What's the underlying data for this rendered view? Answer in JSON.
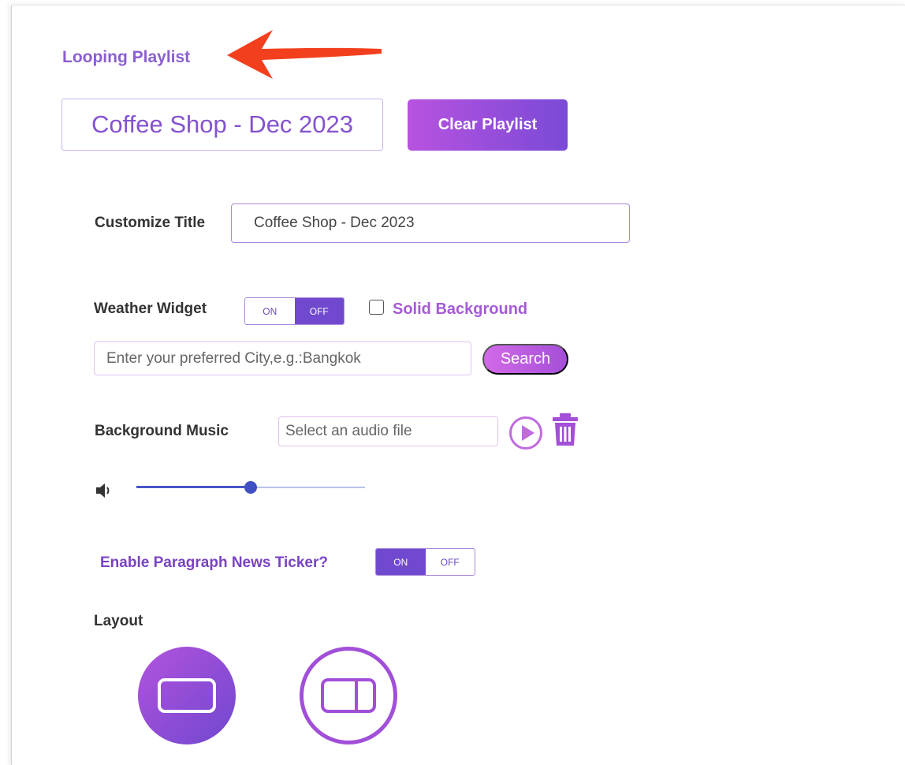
{
  "header": {
    "title": "Looping Playlist",
    "playlist_name": "Coffee Shop - Dec 2023",
    "clear_button": "Clear Playlist"
  },
  "customize_title": {
    "label": "Customize Title",
    "value": "Coffee Shop - Dec 2023"
  },
  "weather": {
    "label": "Weather Widget",
    "toggle_on": "ON",
    "toggle_off": "OFF",
    "selected": "OFF",
    "solid_background_label": "Solid Background",
    "solid_background_checked": false,
    "city_placeholder": "Enter your preferred City,e.g.:Bangkok",
    "search_button": "Search"
  },
  "music": {
    "label": "Background Music",
    "file_placeholder": "Select an audio file",
    "volume": 0.5
  },
  "news_ticker": {
    "label": "Enable Paragraph News Ticker?",
    "toggle_on": "ON",
    "toggle_off": "OFF",
    "selected": "ON"
  },
  "layout": {
    "label": "Layout",
    "options": [
      "single-screen-icon",
      "split-screen-icon"
    ],
    "selected_index": 0
  },
  "icons": {
    "annotation": "arrow-left-icon",
    "play": "play-icon",
    "delete": "trash-icon",
    "volume": "speaker-icon"
  },
  "colors": {
    "accent": "#7a4ad6",
    "gradient_start": "#b753e0",
    "annotation_arrow": "#f2401e"
  }
}
